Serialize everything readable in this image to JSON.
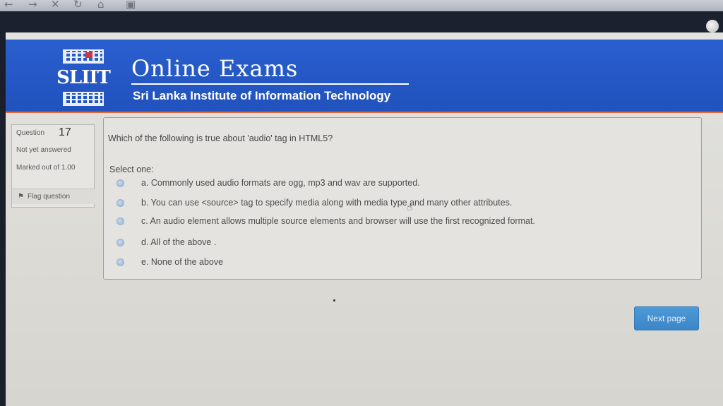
{
  "browser": {
    "nav_icons": [
      "back-arrow-icon",
      "forward-arrow-icon",
      "close-icon",
      "refresh-icon",
      "home-icon",
      "bookmark-icon"
    ]
  },
  "header": {
    "logo_text": "SLIIT",
    "title": "Online Exams",
    "subtitle": "Sri Lanka Institute of Information Technology",
    "banner_color": "#2356c4",
    "accent_line_color": "#e46a3d"
  },
  "question_info": {
    "label": "Question",
    "number": "17",
    "status": "Not yet answered",
    "marked_out_of": "Marked out of 1.00",
    "flag_label": "Flag question"
  },
  "question": {
    "text": "Which of the following is true about 'audio' tag in HTML5?",
    "select_prompt": "Select one:",
    "options": [
      "a. Commonly used audio formats are ogg, mp3 and wav are supported.",
      "b. You can use <source> tag to specify media along with media type and many other attributes.",
      "c. An audio element allows multiple source elements and browser will use the first recognized format.",
      "d. All of the above .",
      "e. None of the above"
    ]
  },
  "footer": {
    "next_label": "Next page",
    "next_color": "#3f8bcc"
  }
}
